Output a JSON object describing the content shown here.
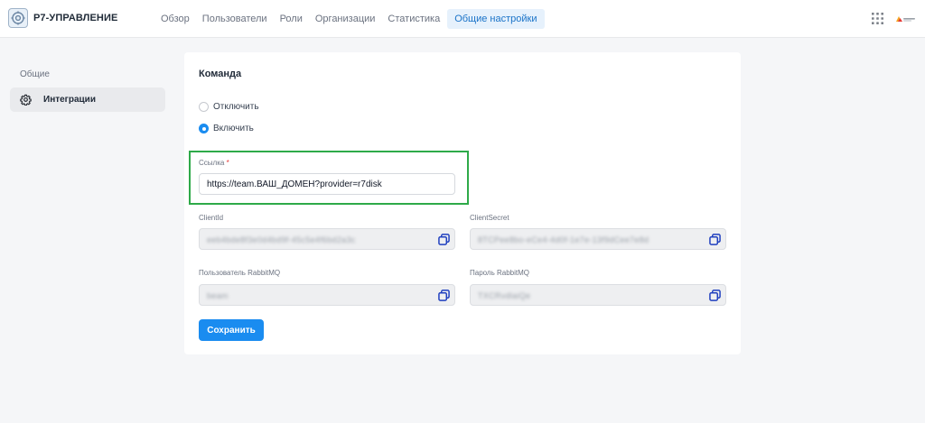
{
  "app": {
    "name": "Р7-УПРАВЛЕНИЕ"
  },
  "nav": {
    "items": [
      {
        "label": "Обзор"
      },
      {
        "label": "Пользователи"
      },
      {
        "label": "Роли"
      },
      {
        "label": "Организации"
      },
      {
        "label": "Статистика"
      },
      {
        "label": "Общие настройки",
        "active": true
      }
    ]
  },
  "sidebar": {
    "section_label": "Общие",
    "items": [
      {
        "label": "Интеграции",
        "icon": "gear-icon",
        "active": true
      }
    ]
  },
  "card": {
    "title": "Команда",
    "radio_options": [
      {
        "label": "Отключить",
        "checked": false
      },
      {
        "label": "Включить",
        "checked": true
      }
    ],
    "link": {
      "label": "Ссылка",
      "required_mark": "*",
      "value": "https://team.ВАШ_ДОМЕН?provider=r7disk"
    },
    "client_id": {
      "label": "ClientId"
    },
    "client_secret": {
      "label": "ClientSecret"
    },
    "rabbit_user": {
      "label": "Пользователь RabbitMQ"
    },
    "rabbit_password": {
      "label": "Пароль RabbitMQ"
    },
    "save_label": "Сохранить"
  },
  "colors": {
    "accent": "#1a8cf0",
    "highlight": "#2eaa49",
    "active_nav_bg": "#e6f1fc"
  }
}
